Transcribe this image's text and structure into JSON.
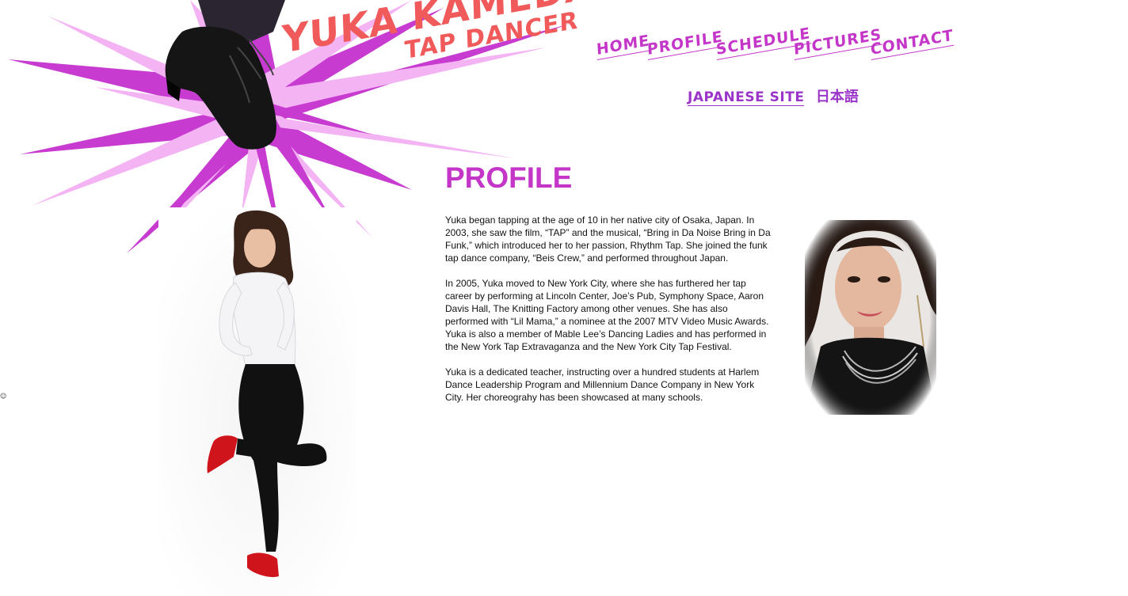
{
  "logo": {
    "name": "YUKA KAMEDA",
    "role": "TAP DANCER"
  },
  "nav": {
    "home": "HOME",
    "profile": "PROFILE",
    "schedule": "SCHEDULE",
    "pictures": "PICTURES",
    "contact": "CONTACT"
  },
  "language": {
    "link": "JAPANESE SITE",
    "native": "日本語"
  },
  "page_title": "PROFILE",
  "bio": {
    "p1": "Yuka began tapping at the age of 10 in her native city of Osaka, Japan. In 2003, she saw the film, “TAP” and the musical, “Bring in Da Noise Bring in Da Funk,” which introduced her to her passion, Rhythm Tap. She joined the funk tap dance company, “Beis Crew,” and performed throughout Japan.",
    "p2": "In 2005, Yuka moved to New York City, where she has furthered her tap career by performing at Lincoln Center, Joe’s Pub, Symphony Space, Aaron Davis Hall, The Knitting Factory among other venues. She has also performed with “Lil Mama,” a nominee at the 2007 MTV Video Music Awards. Yuka is also a member of Mable Lee’s Dancing Ladies and has performed in the New York Tap Extravaganza and the New York City Tap Festival.",
    "p3": "Yuka is a dedicated teacher, instructing over a hundred students at Harlem Dance Leadership Program and Millennium Dance Company in New York City. Her choreograhy has been showcased at many schools."
  },
  "colors": {
    "accent": "#c436c8",
    "logo": "#f05a5a",
    "burst_dark": "#c73bd0",
    "burst_light": "#f4b4f4"
  },
  "icons": {
    "marker": "smiley-icon"
  }
}
